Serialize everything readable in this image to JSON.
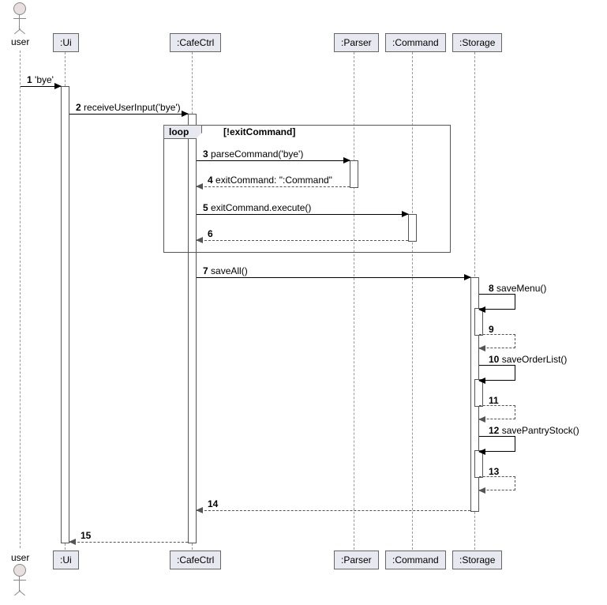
{
  "actors": {
    "user_top": "user",
    "user_bottom": "user"
  },
  "participants": {
    "ui": ":Ui",
    "cafectrl": ":CafeCtrl",
    "parser": ":Parser",
    "command": ":Command",
    "storage": ":Storage"
  },
  "loop": {
    "label": "loop",
    "guard": "[!exitCommand]"
  },
  "messages": {
    "m1": {
      "num": "1",
      "text": "'bye'"
    },
    "m2": {
      "num": "2",
      "text": "receiveUserInput('bye')"
    },
    "m3": {
      "num": "3",
      "text": "parseCommand('bye')"
    },
    "m4": {
      "num": "4",
      "text": "exitCommand: \":Command\""
    },
    "m5": {
      "num": "5",
      "text": "exitCommand.execute()"
    },
    "m6": {
      "num": "6",
      "text": ""
    },
    "m7": {
      "num": "7",
      "text": "saveAll()"
    },
    "m8": {
      "num": "8",
      "text": "saveMenu()"
    },
    "m9": {
      "num": "9",
      "text": ""
    },
    "m10": {
      "num": "10",
      "text": "saveOrderList()"
    },
    "m11": {
      "num": "11",
      "text": ""
    },
    "m12": {
      "num": "12",
      "text": "savePantryStock()"
    },
    "m13": {
      "num": "13",
      "text": ""
    },
    "m14": {
      "num": "14",
      "text": ""
    },
    "m15": {
      "num": "15",
      "text": ""
    }
  },
  "chart_data": {
    "type": "sequence-diagram",
    "actors": [
      "user"
    ],
    "participants": [
      ":Ui",
      ":CafeCtrl",
      ":Parser",
      ":Command",
      ":Storage"
    ],
    "messages": [
      {
        "seq": 1,
        "from": "user",
        "to": ":Ui",
        "label": "'bye'",
        "type": "sync"
      },
      {
        "seq": 2,
        "from": ":Ui",
        "to": ":CafeCtrl",
        "label": "receiveUserInput('bye')",
        "type": "sync"
      },
      {
        "seq": 3,
        "from": ":CafeCtrl",
        "to": ":Parser",
        "label": "parseCommand('bye')",
        "type": "sync",
        "frame": "loop [!exitCommand]"
      },
      {
        "seq": 4,
        "from": ":Parser",
        "to": ":CafeCtrl",
        "label": "exitCommand: \":Command\"",
        "type": "return",
        "frame": "loop"
      },
      {
        "seq": 5,
        "from": ":CafeCtrl",
        "to": ":Command",
        "label": "exitCommand.execute()",
        "type": "sync",
        "frame": "loop"
      },
      {
        "seq": 6,
        "from": ":Command",
        "to": ":CafeCtrl",
        "label": "",
        "type": "return",
        "frame": "loop"
      },
      {
        "seq": 7,
        "from": ":CafeCtrl",
        "to": ":Storage",
        "label": "saveAll()",
        "type": "sync"
      },
      {
        "seq": 8,
        "from": ":Storage",
        "to": ":Storage",
        "label": "saveMenu()",
        "type": "self-sync"
      },
      {
        "seq": 9,
        "from": ":Storage",
        "to": ":Storage",
        "label": "",
        "type": "self-return"
      },
      {
        "seq": 10,
        "from": ":Storage",
        "to": ":Storage",
        "label": "saveOrderList()",
        "type": "self-sync"
      },
      {
        "seq": 11,
        "from": ":Storage",
        "to": ":Storage",
        "label": "",
        "type": "self-return"
      },
      {
        "seq": 12,
        "from": ":Storage",
        "to": ":Storage",
        "label": "savePantryStock()",
        "type": "self-sync"
      },
      {
        "seq": 13,
        "from": ":Storage",
        "to": ":Storage",
        "label": "",
        "type": "self-return"
      },
      {
        "seq": 14,
        "from": ":Storage",
        "to": ":CafeCtrl",
        "label": "",
        "type": "return"
      },
      {
        "seq": 15,
        "from": ":CafeCtrl",
        "to": ":Ui",
        "label": "",
        "type": "return"
      }
    ],
    "fragments": [
      {
        "type": "loop",
        "guard": "!exitCommand",
        "covers_seq": [
          3,
          4,
          5,
          6
        ]
      }
    ]
  }
}
